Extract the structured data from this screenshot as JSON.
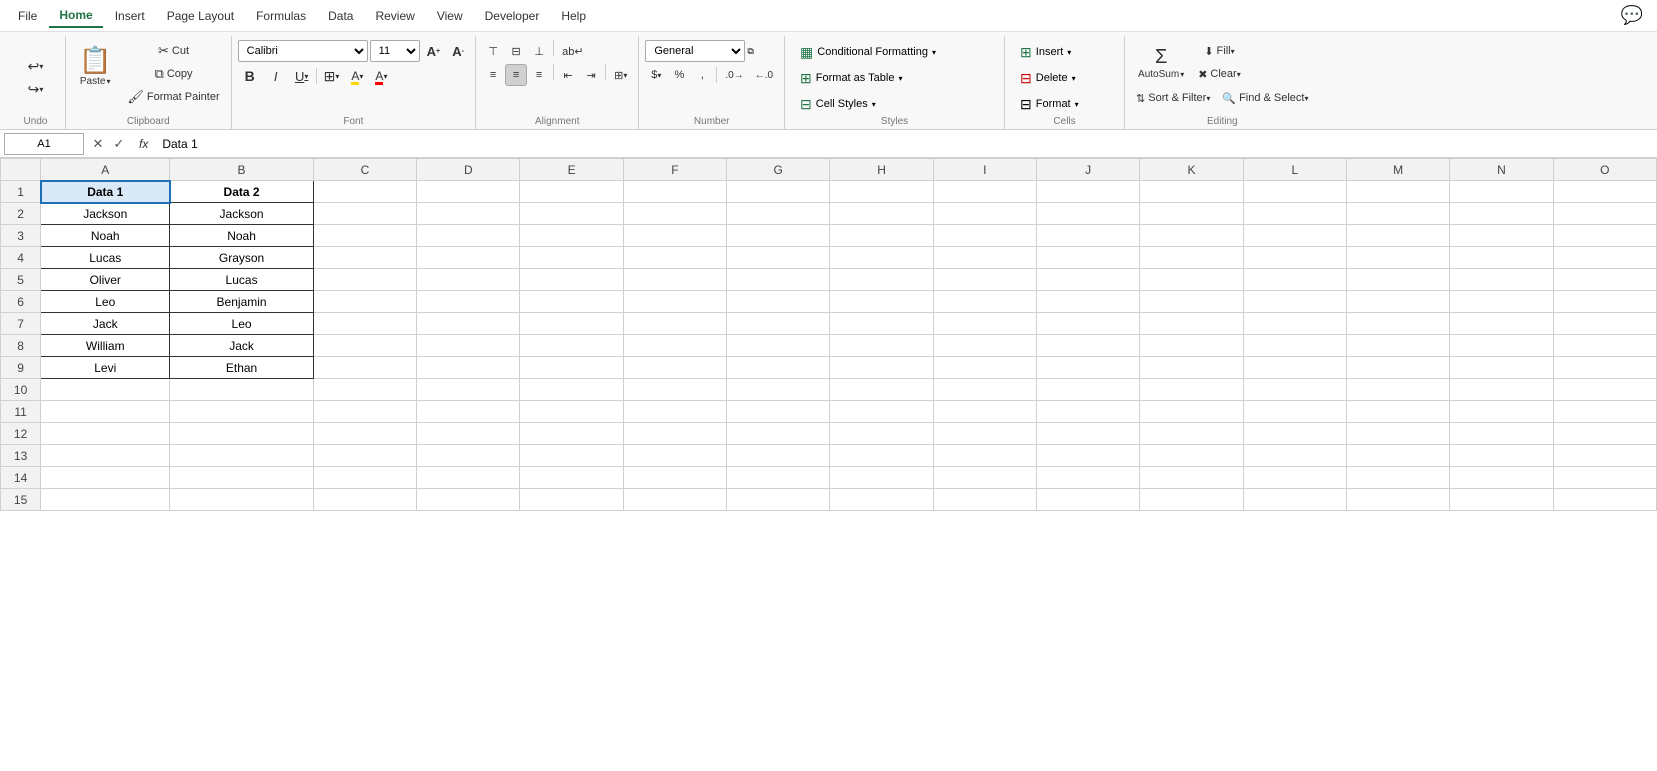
{
  "tabs": {
    "items": [
      "File",
      "Home",
      "Insert",
      "Page Layout",
      "Formulas",
      "Data",
      "Review",
      "View",
      "Developer",
      "Help"
    ],
    "active": "Home"
  },
  "ribbon": {
    "undo_label": "Undo",
    "redo_label": "Redo",
    "clipboard": {
      "paste_label": "Paste",
      "cut_label": "Cut",
      "copy_label": "Copy",
      "format_painter_label": "Format Painter",
      "group_label": "Clipboard"
    },
    "font": {
      "name": "Calibri",
      "size": "11",
      "grow_label": "A",
      "shrink_label": "A",
      "bold_label": "B",
      "italic_label": "I",
      "underline_label": "U",
      "borders_label": "Borders",
      "fill_label": "Fill",
      "color_label": "A",
      "group_label": "Font"
    },
    "alignment": {
      "top_align": "⊤",
      "middle_align": "≡",
      "bottom_align": "⊥",
      "left_align": "≡",
      "center_align": "≡",
      "right_align": "≡",
      "wrap_label": "ab",
      "merge_label": "Merge",
      "decrease_indent": "←",
      "increase_indent": "→",
      "group_label": "Alignment"
    },
    "number": {
      "format": "General",
      "accounting_label": "$",
      "percent_label": "%",
      "comma_label": ",",
      "increase_decimal": ".0",
      "decrease_decimal": ".00",
      "group_label": "Number"
    },
    "styles": {
      "conditional_formatting": "Conditional Formatting",
      "format_as_table": "Format as Table",
      "cell_styles": "Cell Styles",
      "group_label": "Styles"
    },
    "cells": {
      "insert": "Insert",
      "delete": "Delete",
      "format": "Format",
      "group_label": "Cells"
    },
    "editing": {
      "autosum": "Σ",
      "fill": "Fill",
      "clear": "Clear",
      "sort_filter": "Sort & Filter",
      "find_select": "Find & Select",
      "group_label": "Editing"
    }
  },
  "formula_bar": {
    "cell_ref": "A1",
    "formula_content": "Data 1",
    "fx_label": "fx"
  },
  "spreadsheet": {
    "columns": [
      "A",
      "B",
      "C",
      "D",
      "E",
      "F",
      "G",
      "H",
      "I",
      "J",
      "K",
      "L",
      "M",
      "N",
      "O"
    ],
    "rows": [
      {
        "num": 1,
        "cells": [
          {
            "val": "Data 1",
            "bold": true
          },
          {
            "val": "Data 2",
            "bold": true
          },
          "",
          "",
          "",
          "",
          "",
          "",
          "",
          "",
          "",
          "",
          "",
          "",
          ""
        ]
      },
      {
        "num": 2,
        "cells": [
          "Jackson",
          "Jackson",
          "",
          "",
          "",
          "",
          "",
          "",
          "",
          "",
          "",
          "",
          "",
          "",
          ""
        ]
      },
      {
        "num": 3,
        "cells": [
          "Noah",
          "Noah",
          "",
          "",
          "",
          "",
          "",
          "",
          "",
          "",
          "",
          "",
          "",
          "",
          ""
        ]
      },
      {
        "num": 4,
        "cells": [
          "Lucas",
          "Grayson",
          "",
          "",
          "",
          "",
          "",
          "",
          "",
          "",
          "",
          "",
          "",
          "",
          ""
        ]
      },
      {
        "num": 5,
        "cells": [
          "Oliver",
          "Lucas",
          "",
          "",
          "",
          "",
          "",
          "",
          "",
          "",
          "",
          "",
          "",
          "",
          ""
        ]
      },
      {
        "num": 6,
        "cells": [
          "Leo",
          "Benjamin",
          "",
          "",
          "",
          "",
          "",
          "",
          "",
          "",
          "",
          "",
          "",
          "",
          ""
        ]
      },
      {
        "num": 7,
        "cells": [
          "Jack",
          "Leo",
          "",
          "",
          "",
          "",
          "",
          "",
          "",
          "",
          "",
          "",
          "",
          "",
          ""
        ]
      },
      {
        "num": 8,
        "cells": [
          "William",
          "Jack",
          "",
          "",
          "",
          "",
          "",
          "",
          "",
          "",
          "",
          "",
          "",
          "",
          ""
        ]
      },
      {
        "num": 9,
        "cells": [
          "Levi",
          "Ethan",
          "",
          "",
          "",
          "",
          "",
          "",
          "",
          "",
          "",
          "",
          "",
          "",
          ""
        ]
      },
      {
        "num": 10,
        "cells": [
          "",
          "",
          "",
          "",
          "",
          "",
          "",
          "",
          "",
          "",
          "",
          "",
          "",
          "",
          ""
        ]
      },
      {
        "num": 11,
        "cells": [
          "",
          "",
          "",
          "",
          "",
          "",
          "",
          "",
          "",
          "",
          "",
          "",
          "",
          "",
          ""
        ]
      },
      {
        "num": 12,
        "cells": [
          "",
          "",
          "",
          "",
          "",
          "",
          "",
          "",
          "",
          "",
          "",
          "",
          "",
          "",
          ""
        ]
      },
      {
        "num": 13,
        "cells": [
          "",
          "",
          "",
          "",
          "",
          "",
          "",
          "",
          "",
          "",
          "",
          "",
          "",
          "",
          ""
        ]
      },
      {
        "num": 14,
        "cells": [
          "",
          "",
          "",
          "",
          "",
          "",
          "",
          "",
          "",
          "",
          "",
          "",
          "",
          "",
          ""
        ]
      },
      {
        "num": 15,
        "cells": [
          "",
          "",
          "",
          "",
          "",
          "",
          "",
          "",
          "",
          "",
          "",
          "",
          "",
          "",
          ""
        ]
      }
    ],
    "selected_cell": "A1"
  },
  "icons": {
    "undo": "↩",
    "redo": "↪",
    "cut": "✂",
    "copy": "⧉",
    "format_painter": "🖌",
    "bold": "B",
    "italic": "I",
    "underline": "U",
    "borders": "⊞",
    "fill_color": "A",
    "font_color": "A",
    "grow": "A↑",
    "shrink": "A↓",
    "wrap_text": "↵",
    "merge": "⊞",
    "align_top": "⬆",
    "align_middle": "⬌",
    "align_bottom": "⬇",
    "align_left": "⬅",
    "align_center": "⬌",
    "align_right": "➡",
    "decrease_indent": "⇤",
    "increase_indent": "⇥",
    "cond_format_icon": "🟩",
    "table_icon": "⊞",
    "styles_icon": "⊞",
    "insert_icon": "⊞",
    "delete_icon": "⊟",
    "format_icon": "⊟",
    "sum_icon": "Σ",
    "fill_icon": "⬇",
    "sort_icon": "⇅",
    "find_icon": "🔍",
    "chevron_down": "▾",
    "expand": "⧉"
  }
}
